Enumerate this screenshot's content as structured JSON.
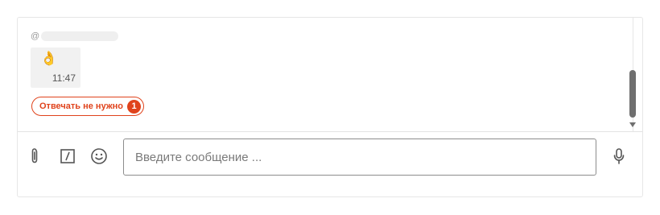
{
  "message": {
    "sender_prefix": "@",
    "emoji": "👌",
    "time": "11:47"
  },
  "badge": {
    "label": "Отвечать не нужно",
    "count": "1"
  },
  "composer": {
    "placeholder": "Введите сообщение ...",
    "tools": [
      "paperclip-icon",
      "slash-command-icon",
      "smiley-icon"
    ],
    "send_tool": "microphone-icon"
  },
  "colors": {
    "accent": "#e0431c",
    "scroll_thumb": "#6f6f6f",
    "bubble": "#f1f1f1"
  }
}
